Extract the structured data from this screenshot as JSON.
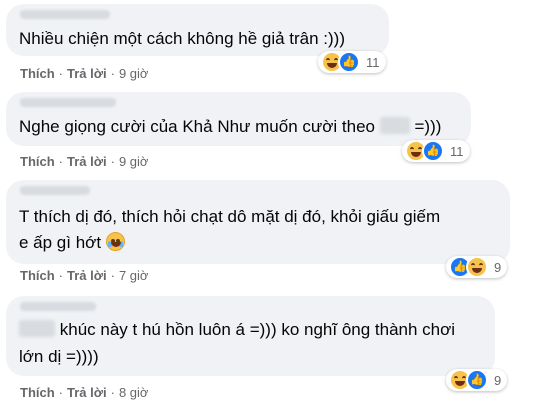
{
  "comments": [
    {
      "text": "Nhiều chiện một cách không hề giả trân :)))",
      "like_label": "Thích",
      "reply_label": "Trả lời",
      "time": "9 giờ",
      "reaction_count": "11",
      "reaction_icons": [
        "haha-icon",
        "like-icon"
      ]
    },
    {
      "text_before": "Nghe giọng cười của Khả Như muốn cười theo",
      "text_after": "=)))",
      "like_label": "Thích",
      "reply_label": "Trả lời",
      "time": "9 giờ",
      "reaction_count": "11",
      "reaction_icons": [
        "haha-icon",
        "like-icon"
      ]
    },
    {
      "line1": "T thích dị đó, thích hỏi chạt dô mặt dị đó, khỏi giấu giếm",
      "line2": "e ấp gì hớt",
      "like_label": "Thích",
      "reply_label": "Trả lời",
      "time": "7 giờ",
      "reaction_count": "9",
      "reaction_icons": [
        "like-icon",
        "haha-icon"
      ]
    },
    {
      "line1": "khúc này t hú hồn luôn á =))) ko nghĩ ông thành chơi",
      "line2": "lớn dị =))))",
      "like_label": "Thích",
      "reply_label": "Trả lời",
      "time": "8 giờ",
      "reaction_count": "9",
      "reaction_icons": [
        "haha-icon",
        "like-icon"
      ]
    }
  ],
  "colors": {
    "bubble": "#f0f2f5",
    "meta_text": "#65676b",
    "like_blue": "#1877f2",
    "haha_yellow": "#f7c24b"
  }
}
